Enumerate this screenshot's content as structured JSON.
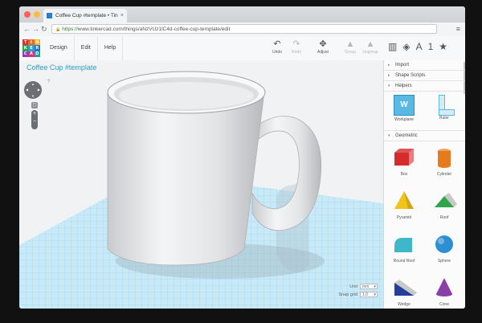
{
  "browser": {
    "tab_title": "Coffee Cup #template • Tin",
    "tab_close": "×",
    "url_scheme": "https://",
    "url_rest": "www.tinkercad.com/things/aNzVUz1lC4d-coffee-cup-template/edit",
    "back": "←",
    "forward": "→",
    "reload": "↻",
    "menu": "≡",
    "lock": "🔒",
    "window_button_colors": [
      "#fc605c",
      "#fdbc40",
      "#34c84a"
    ]
  },
  "app": {
    "logo_letters": [
      "T",
      "I",
      "N",
      "K",
      "E",
      "R",
      "C",
      "A",
      "D"
    ],
    "logo_colors": [
      "#e0302c",
      "#e86d1f",
      "#f4b428",
      "#23a55c",
      "#2d9cdb",
      "#2672c8",
      "#8a3fb5",
      "#d6337f",
      "#17a69a"
    ],
    "menu": [
      "Design",
      "Edit",
      "Help"
    ],
    "tools": [
      {
        "label": "Undo",
        "icon": "↶",
        "enabled": true
      },
      {
        "label": "Redo",
        "icon": "↷",
        "enabled": false
      },
      {
        "label": "Adjust",
        "icon": "✥",
        "enabled": true
      },
      {
        "label": "Group",
        "icon": "▲",
        "enabled": false
      },
      {
        "label": "Ungroup",
        "icon": "▲",
        "enabled": false
      }
    ],
    "top_icons": [
      "▥",
      "◈",
      "A",
      "1",
      "★"
    ],
    "design_title": "Coffee Cup #template",
    "help_mark": "?",
    "home_icon": "⌂",
    "fit_icon": "◻",
    "zoom_in": "+",
    "zoom_out": "−",
    "unit_label": "Unit",
    "unit_value": "mm",
    "snap_label": "Snap grid",
    "snap_value": "1.0"
  },
  "sidebar": {
    "sections": [
      {
        "label": "Import",
        "caret": "▸"
      },
      {
        "label": "Shape Scripts",
        "caret": "▸"
      },
      {
        "label": "Helpers",
        "caret": "▾"
      }
    ],
    "helpers": [
      {
        "label": "Workplane",
        "icon": "workplane-icon",
        "glyph": "W"
      },
      {
        "label": "Ruler",
        "icon": "ruler-icon",
        "glyph": "L"
      }
    ],
    "geometric_label": "Geometric",
    "geometric_caret": "▾",
    "shapes": [
      {
        "label": "Box",
        "icon": "box-icon",
        "color": "#d52b2b"
      },
      {
        "label": "Cylinder",
        "icon": "cylinder-icon",
        "color": "#e57b1c"
      },
      {
        "label": "Pyramid",
        "icon": "pyramid-icon",
        "color": "#f2c31b"
      },
      {
        "label": "Roof",
        "icon": "roof-icon",
        "color": "#2fa64a"
      },
      {
        "label": "Round Roof",
        "icon": "round-roof-icon",
        "color": "#40b6c9"
      },
      {
        "label": "Sphere",
        "icon": "sphere-icon",
        "color": "#2c8fd2"
      },
      {
        "label": "Wedge",
        "icon": "wedge-icon",
        "color": "#233f9b"
      },
      {
        "label": "Cone",
        "icon": "cone-icon",
        "color": "#8a3ea8"
      }
    ]
  }
}
